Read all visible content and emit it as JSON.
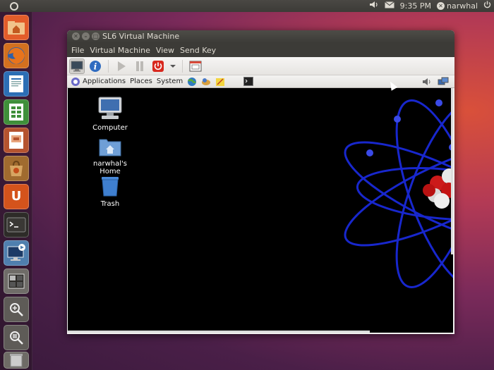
{
  "top_panel": {
    "time": "9:35 PM",
    "username": "narwhal",
    "icons": [
      "dash-icon",
      "volume-icon",
      "mail-icon",
      "user-icon",
      "power-icon"
    ]
  },
  "launcher": {
    "items": [
      {
        "name": "home-folder",
        "color": "#e25c2a"
      },
      {
        "name": "firefox",
        "color": "#c0651e"
      },
      {
        "name": "writer",
        "color": "#2c6eb5"
      },
      {
        "name": "calc",
        "color": "#3f8f3a"
      },
      {
        "name": "impress",
        "color": "#b5532f"
      },
      {
        "name": "software-center",
        "color": "#a06b2f"
      },
      {
        "name": "ubuntu-one",
        "color": "#c44d1a"
      },
      {
        "name": "terminal",
        "color": "#2d2b28"
      },
      {
        "name": "vm-manager",
        "color": "#4f7fae"
      },
      {
        "name": "workspace-switcher",
        "color": "#6f6c68"
      },
      {
        "name": "zoom",
        "color": "#5e5b57"
      },
      {
        "name": "search",
        "color": "#5e5b57"
      },
      {
        "name": "trash",
        "color": "#6e6b66"
      }
    ]
  },
  "vm_window": {
    "title": "SL6 Virtual Machine",
    "menu": [
      "File",
      "Virtual Machine",
      "View",
      "Send Key"
    ]
  },
  "guest": {
    "panel_menus": [
      "Applications",
      "Places",
      "System"
    ],
    "desktop_icons": [
      {
        "label": "Computer",
        "icon": "computer-icon"
      },
      {
        "label": "narwhal's Home",
        "icon": "home-folder-icon"
      },
      {
        "label": "Trash",
        "icon": "trash-icon"
      }
    ]
  },
  "colors": {
    "panel_bg": "#3c3b37",
    "atom_orbit": "#1a2ad8",
    "guest_bg": "#000000"
  }
}
